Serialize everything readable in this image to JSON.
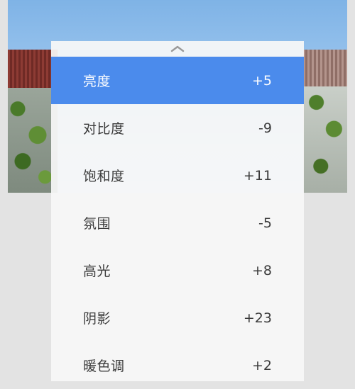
{
  "adjustments": [
    {
      "label": "亮度",
      "value": "+5",
      "selected": true
    },
    {
      "label": "对比度",
      "value": "-9",
      "selected": false
    },
    {
      "label": "饱和度",
      "value": "+11",
      "selected": false
    },
    {
      "label": "氛围",
      "value": "-5",
      "selected": false
    },
    {
      "label": "高光",
      "value": "+8",
      "selected": false
    },
    {
      "label": "阴影",
      "value": "+23",
      "selected": false
    },
    {
      "label": "暖色调",
      "value": "+2",
      "selected": false
    }
  ],
  "colors": {
    "selected_row": "#4b8bec",
    "panel_bg": "#f7f7f7",
    "text": "#3a3a3a"
  },
  "icons": {
    "collapse": "chevron-up-icon"
  }
}
